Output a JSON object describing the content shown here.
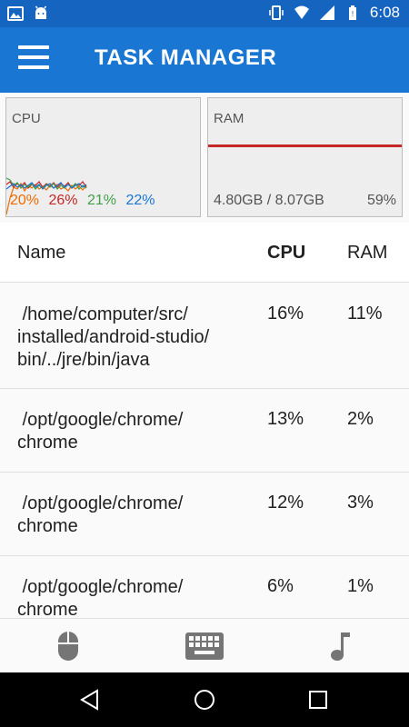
{
  "status_bar": {
    "time": "6:08",
    "icons_left": [
      "image-icon",
      "android-icon"
    ],
    "icons_right": [
      "vibrate-icon",
      "wifi-icon",
      "signal-icon",
      "battery-icon"
    ]
  },
  "app_bar": {
    "title": "TASK MANAGER",
    "menu_icon": "hamburger-menu-icon",
    "color": "#1976d2"
  },
  "monitors": {
    "cpu": {
      "label": "CPU",
      "core_values": [
        {
          "text": "20%",
          "color": "#ef6c00"
        },
        {
          "text": "26%",
          "color": "#c62828"
        },
        {
          "text": "21%",
          "color": "#43a047"
        },
        {
          "text": "22%",
          "color": "#1976d2"
        }
      ]
    },
    "ram": {
      "label": "RAM",
      "used_text": "4.80GB / 8.07GB",
      "percent_text": "59%",
      "line_color": "#c62828"
    }
  },
  "table": {
    "headers": {
      "name": "Name",
      "cpu": "CPU",
      "ram": "RAM"
    },
    "sorted_by": "cpu",
    "rows": [
      {
        "name": " /home/computer/src/\ninstalled/android-studio/\nbin/../jre/bin/java",
        "cpu": "16%",
        "ram": "11%"
      },
      {
        "name": " /opt/google/chrome/\nchrome",
        "cpu": "13%",
        "ram": "2%"
      },
      {
        "name": " /opt/google/chrome/\nchrome",
        "cpu": "12%",
        "ram": "3%"
      },
      {
        "name": " /opt/google/chrome/\nchrome",
        "cpu": "6%",
        "ram": "1%"
      }
    ]
  },
  "bottom_tabs": [
    "mouse-icon",
    "keyboard-icon",
    "music-note-icon"
  ],
  "nav_bar": [
    "back-icon",
    "home-icon",
    "recents-icon"
  ]
}
